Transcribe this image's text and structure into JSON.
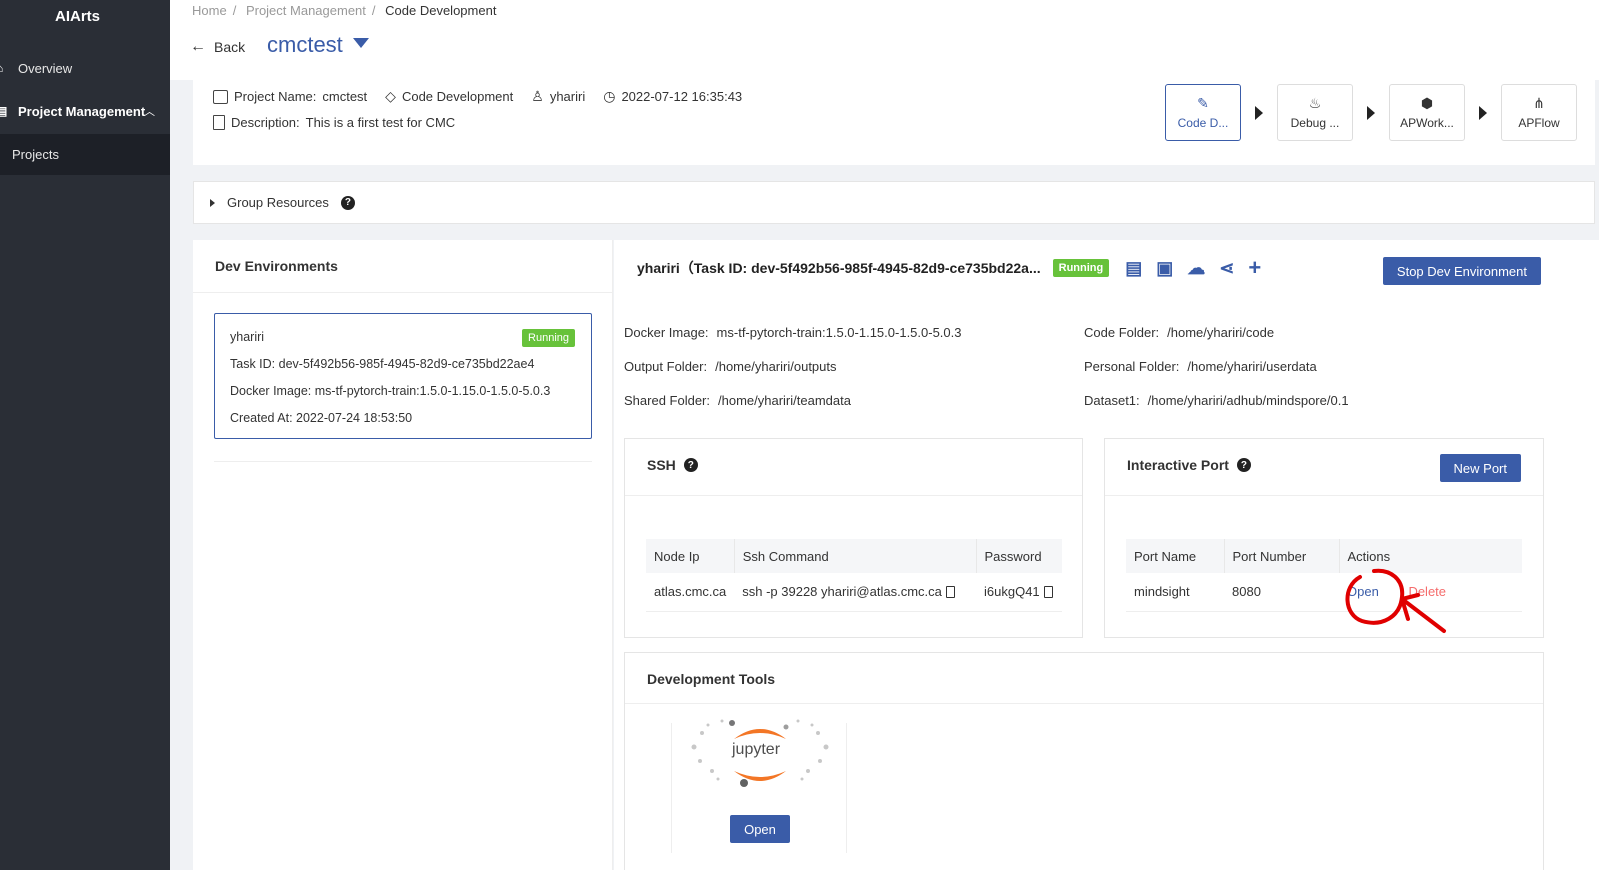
{
  "app": {
    "name": "AIArts"
  },
  "sidebar": {
    "items": [
      {
        "label": "Overview"
      },
      {
        "label": "Project Management"
      },
      {
        "label": "Projects"
      }
    ]
  },
  "breadcrumb": [
    "Home",
    "Project Management",
    "Code Development"
  ],
  "header": {
    "back_label": "Back",
    "project": "cmctest"
  },
  "project_info": {
    "name_label": "Project Name:",
    "name": "cmctest",
    "stage": "Code Development",
    "user": "yhariri",
    "time": "2022-07-12 16:35:43",
    "desc_label": "Description:",
    "desc": "This is a first test for CMC"
  },
  "steps": [
    {
      "label": "Code D...",
      "icon": "edit-icon"
    },
    {
      "label": "Debug ...",
      "icon": "flame-icon"
    },
    {
      "label": "APWork...",
      "icon": "cube-icon"
    },
    {
      "label": "APFlow",
      "icon": "flow-icon"
    }
  ],
  "group_resources": {
    "label": "Group Resources"
  },
  "dev_env": {
    "title": "Dev Environments",
    "card": {
      "user": "yhariri",
      "status": "Running",
      "task_label": "Task ID:",
      "task_id": "dev-5f492b56-985f-4945-82d9-ce735bd22ae4",
      "image_label": "Docker Image:",
      "image": "ms-tf-pytorch-train:1.5.0-1.15.0-1.5.0-5.0.3",
      "created_label": "Created At:",
      "created": "2022-07-24 18:53:50"
    }
  },
  "detail": {
    "title": "yhariri（Task ID: dev-5f492b56-985f-4945-82d9-ce735bd22a...",
    "status": "Running",
    "stop_label": "Stop Dev Environment",
    "fields": {
      "docker_label": "Docker Image:",
      "docker": "ms-tf-pytorch-train:1.5.0-1.15.0-1.5.0-5.0.3",
      "output_label": "Output Folder:",
      "output": "/home/yhariri/outputs",
      "shared_label": "Shared Folder:",
      "shared": "/home/yhariri/teamdata",
      "code_label": "Code Folder:",
      "code": "/home/yhariri/code",
      "personal_label": "Personal Folder:",
      "personal": "/home/yhariri/userdata",
      "dataset_label": "Dataset1:",
      "dataset": "/home/yhariri/adhub/mindspore/0.1"
    }
  },
  "ssh": {
    "title": "SSH",
    "headers": [
      "Node Ip",
      "Ssh Command",
      "Password"
    ],
    "row": {
      "node": "atlas.cmc.ca",
      "cmd": "ssh -p 39228 yhariri@atlas.cmc.ca",
      "pwd": "i6ukgQ41"
    }
  },
  "port": {
    "title": "Interactive Port",
    "new_label": "New Port",
    "headers": [
      "Port Name",
      "Port Number",
      "Actions"
    ],
    "row": {
      "name": "mindsight",
      "number": "8080",
      "open": "Open",
      "delete": "Delete"
    }
  },
  "tools": {
    "title": "Development Tools",
    "jupyter_text": "jupyter",
    "open_label": "Open"
  },
  "colors": {
    "accent": "#3a5ca8",
    "running": "#67c23a",
    "danger": "#f56c6c",
    "annotation": "#e00000"
  }
}
